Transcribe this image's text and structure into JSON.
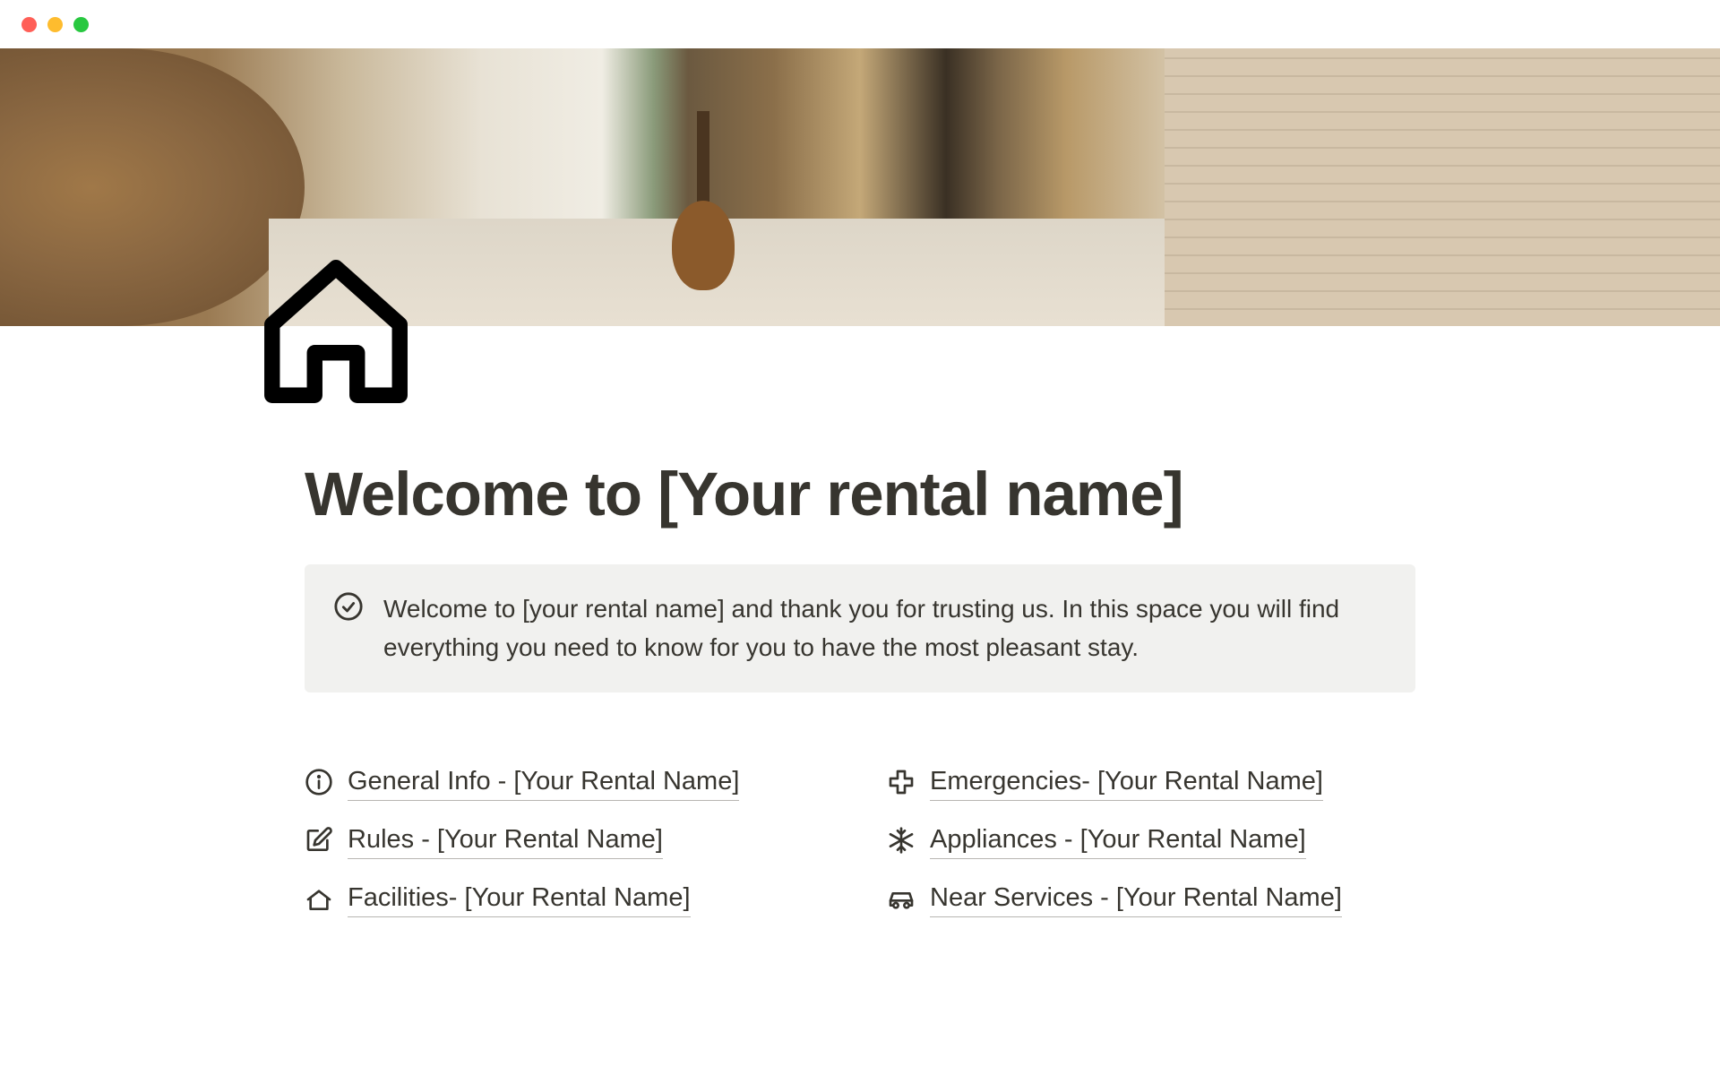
{
  "page": {
    "title": "Welcome to [Your rental name]"
  },
  "callout": {
    "text": "Welcome to [your rental name] and thank you for trusting us. In this space you will find everything you need to know for you to have the most pleasant stay."
  },
  "links": {
    "left": [
      {
        "icon": "info",
        "label": "General Info - [Your Rental Name]"
      },
      {
        "icon": "edit",
        "label": "Rules - [Your Rental Name]"
      },
      {
        "icon": "house-small",
        "label": "Facilities- [Your Rental Name]"
      }
    ],
    "right": [
      {
        "icon": "plus-medical",
        "label": "Emergencies- [Your Rental Name]"
      },
      {
        "icon": "snowflake",
        "label": "Appliances - [Your Rental Name]"
      },
      {
        "icon": "car",
        "label": "Near Services - [Your Rental Name]"
      }
    ]
  }
}
